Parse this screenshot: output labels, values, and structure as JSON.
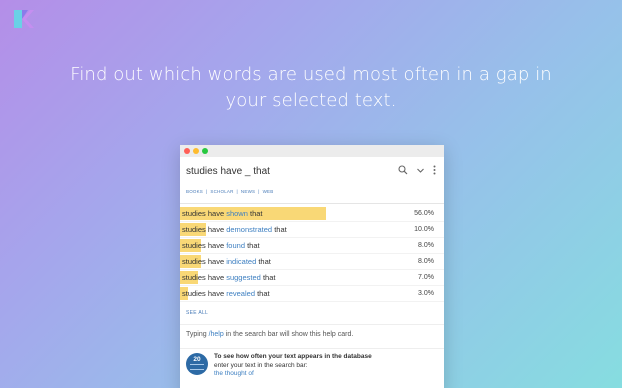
{
  "headline": {
    "line1": "Find out which words are used most often in a gap in",
    "line2": "your selected text."
  },
  "window": {
    "search": {
      "value": "studies have _ that"
    },
    "filters": [
      "BOOKS",
      "SCHOLAR",
      "NEWS",
      "WEB"
    ],
    "results": [
      {
        "prefix": "studies have",
        "word": "shown",
        "suffix": "that",
        "percent": "56.0%",
        "share": 0.56
      },
      {
        "prefix": "studies have",
        "word": "demonstrated",
        "suffix": "that",
        "percent": "10.0%",
        "share": 0.1
      },
      {
        "prefix": "studies have",
        "word": "found",
        "suffix": "that",
        "percent": "8.0%",
        "share": 0.08
      },
      {
        "prefix": "studies have",
        "word": "indicated",
        "suffix": "that",
        "percent": "8.0%",
        "share": 0.08
      },
      {
        "prefix": "studies have",
        "word": "suggested",
        "suffix": "that",
        "percent": "7.0%",
        "share": 0.07
      },
      {
        "prefix": "studies have",
        "word": "revealed",
        "suffix": "that",
        "percent": "3.0%",
        "share": 0.03
      }
    ],
    "see_all": "SEE ALL",
    "help": {
      "pre": "Typing",
      "command": "/help",
      "post": "in the search bar will show this help card."
    },
    "card": {
      "icon_number": "20",
      "title": "To see how often your text appears in the database",
      "body": "enter your text in the search bar:",
      "example": "the thought of"
    }
  },
  "colors": {
    "accent": "#3d7fc1",
    "bar": "#f9d876",
    "gradient_start": "#b48ee8",
    "gradient_end": "#86dde0"
  }
}
